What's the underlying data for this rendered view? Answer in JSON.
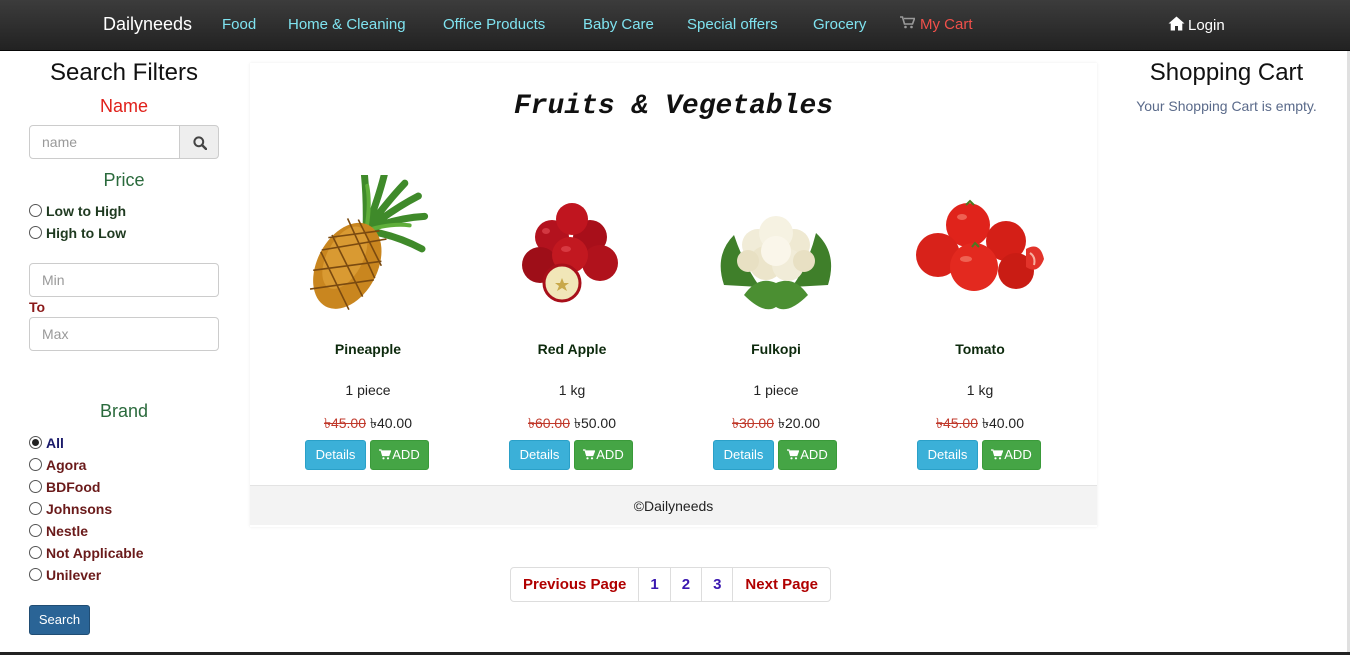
{
  "navbar": {
    "brand": "Dailyneeds",
    "links": [
      "Food",
      "Home & Cleaning",
      "Office Products",
      "Baby Care",
      "Special offers",
      "Grocery"
    ],
    "cart": "My Cart",
    "login": "Login"
  },
  "filters": {
    "title": "Search Filters",
    "name_heading": "Name",
    "name_placeholder": "name",
    "price_heading": "Price",
    "price_options": [
      "Low to High",
      "High to Low"
    ],
    "min_placeholder": "Min",
    "to_label": "To",
    "max_placeholder": "Max",
    "brand_heading": "Brand",
    "brands": [
      "All",
      "Agora",
      "BDFood",
      "Johnsons",
      "Nestle",
      "Not Applicable",
      "Unilever"
    ],
    "selected_brand": "All",
    "search_button": "Search"
  },
  "main": {
    "category_title": "Fruits & Vegetables",
    "details_label": "Details",
    "add_label": "ADD",
    "products": [
      {
        "name": "Pineapple",
        "qty": "1 piece",
        "old_price": "৳45.00",
        "price": "৳40.00"
      },
      {
        "name": "Red Apple",
        "qty": "1 kg",
        "old_price": "৳60.00",
        "price": "৳50.00"
      },
      {
        "name": "Fulkopi",
        "qty": "1 piece",
        "old_price": "৳30.00",
        "price": "৳20.00"
      },
      {
        "name": "Tomato",
        "qty": "1 kg",
        "old_price": "৳45.00",
        "price": "৳40.00"
      }
    ],
    "footer": "©Dailyneeds"
  },
  "pagination": {
    "previous": "Previous Page",
    "pages": [
      "1",
      "2",
      "3"
    ],
    "next": "Next Page"
  },
  "cart": {
    "title": "Shopping Cart",
    "empty_message": "Your Shopping Cart is empty."
  }
}
